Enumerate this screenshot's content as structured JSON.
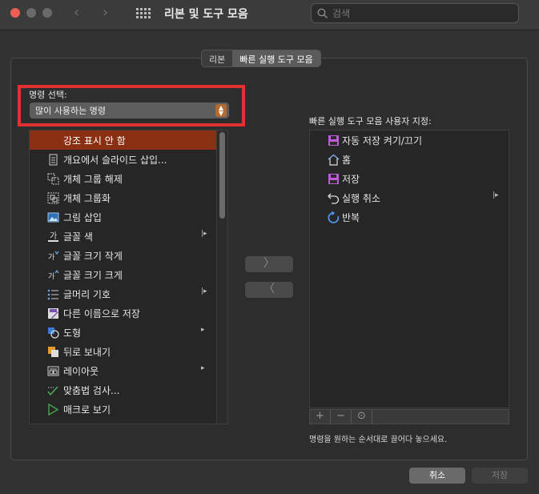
{
  "window": {
    "title": "리본 및 도구 모음",
    "search_placeholder": "검색"
  },
  "tabs": [
    {
      "label": "리본",
      "active": false
    },
    {
      "label": "빠른 실행 도구 모음",
      "active": true
    }
  ],
  "choose_from": {
    "label": "명령 선택:",
    "selected": "많이 사용하는 명령"
  },
  "commands": [
    {
      "label": "강조 표시 안 함",
      "icon": "none",
      "selected": true
    },
    {
      "label": "개요에서 슬라이드 삽입...",
      "icon": "document-icon"
    },
    {
      "label": "개체 그룹 해제",
      "icon": "ungroup-icon"
    },
    {
      "label": "개체 그룹화",
      "icon": "group-icon"
    },
    {
      "label": "그림 삽입",
      "icon": "picture-icon"
    },
    {
      "label": "글꼴 색",
      "icon": "font-color-icon",
      "submenu": "|▸"
    },
    {
      "label": "글꼴 크기 작게",
      "icon": "font-size-decrease-icon"
    },
    {
      "label": "글꼴 크기 크게",
      "icon": "font-size-increase-icon"
    },
    {
      "label": "글머리 기호",
      "icon": "bullets-icon",
      "submenu": "|▸"
    },
    {
      "label": "다른 이름으로 저장",
      "icon": "save-as-icon"
    },
    {
      "label": "도형",
      "icon": "shapes-icon",
      "submenu": "▸"
    },
    {
      "label": "뒤로 보내기",
      "icon": "send-backward-icon"
    },
    {
      "label": "레이아웃",
      "icon": "layout-icon",
      "submenu": "▸"
    },
    {
      "label": "맞춤법 검사...",
      "icon": "spelling-icon"
    },
    {
      "label": "매크로 보기",
      "icon": "macro-play-icon"
    },
    {
      "label": "",
      "icon": "partial-icon"
    }
  ],
  "move_buttons": {
    "add": "〉",
    "remove": "〈"
  },
  "qat": {
    "label": "빠른 실행 도구 모음 사용자 지정:",
    "items": [
      {
        "label": "자동 저장 켜기/끄기",
        "icon": "autosave-icon"
      },
      {
        "label": "홈",
        "icon": "home-icon"
      },
      {
        "label": "저장",
        "icon": "save-icon"
      },
      {
        "label": "실행 취소",
        "icon": "undo-icon",
        "submenu": "|▸"
      },
      {
        "label": "반복",
        "icon": "redo-icon"
      }
    ],
    "toolbar": {
      "add": "+",
      "remove": "−",
      "more": "⊙"
    },
    "hint": "명령을 원하는 순서대로 끌어다 놓으세요."
  },
  "buttons": {
    "cancel": "취소",
    "save": "저장"
  },
  "colors": {
    "accent": "#8b2f12",
    "highlight_box": "#e03232",
    "stepper": "#b56a2f"
  }
}
